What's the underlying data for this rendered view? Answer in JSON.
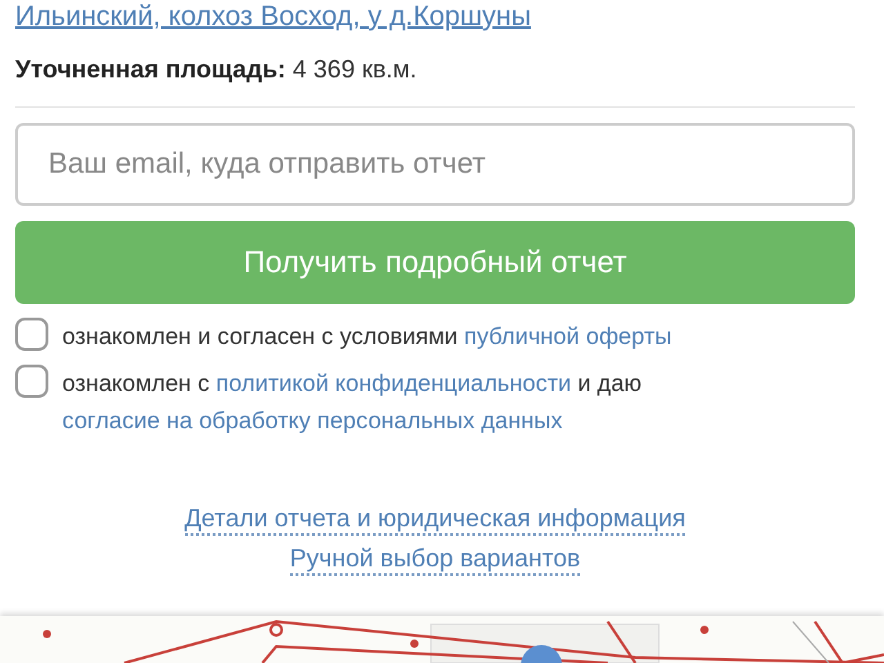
{
  "address_link": "Ильинский, колхоз Восход, у д.Коршуны",
  "area": {
    "label": "Уточненная площадь:",
    "value": "4 369 кв.м."
  },
  "email": {
    "placeholder": "Ваш email, куда отправить отчет"
  },
  "submit": {
    "label": "Получить подробный отчет"
  },
  "consents": [
    {
      "checked": false,
      "parts": [
        {
          "kind": "text",
          "text": "ознакомлен и согласен с условиями "
        },
        {
          "kind": "link",
          "text": "публичной оферты"
        }
      ]
    },
    {
      "checked": false,
      "parts": [
        {
          "kind": "text",
          "text": "ознакомлен с "
        },
        {
          "kind": "link",
          "text": "политикой конфиденциальности"
        },
        {
          "kind": "text",
          "text": " и даю "
        },
        {
          "kind": "link",
          "text": "согласие на обработку персональных данных"
        }
      ]
    }
  ],
  "links": [
    "Детали отчета и юридическая информация",
    "Ручной выбор вариантов"
  ]
}
